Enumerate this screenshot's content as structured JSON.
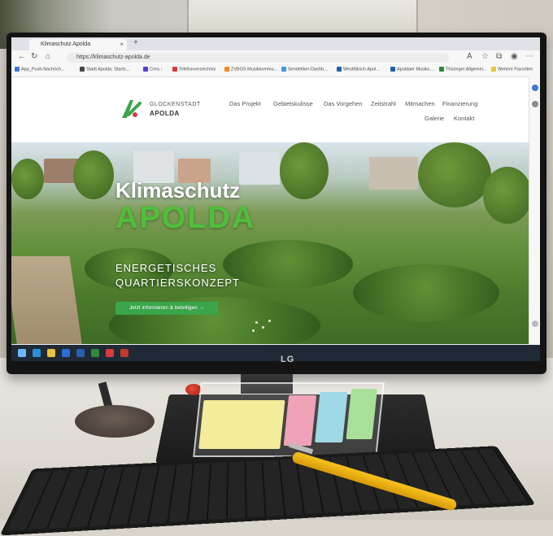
{
  "browser": {
    "tab_title": "Klimaschutz Apolda",
    "tab_close": "×",
    "new_tab": "+",
    "url": "https://klimaschutz-apolda.de",
    "bookmarks": [
      "App_Push-Nachrich...",
      "Stadt Apolda: Starts...",
      "Crea ↑",
      "Telefonverzeichnis",
      "ZVBOS Musikkommu...",
      "Sendetiker-Dashb...",
      "Westfälisch Apol...",
      "Apoldaer Musikc...",
      "Thüringer Allgemei...",
      "Weitere Favoriten"
    ]
  },
  "site": {
    "logo_line1": "GLOCKENSTADT",
    "logo_line2": "APOLDA",
    "nav": [
      "Das Projekt",
      "Gebietskulisse",
      "Das Vorgehen",
      "Zeitstrahl",
      "Mitmachen",
      "Finanzierung",
      "Galerie",
      "Kontakt"
    ],
    "hero_title1": "Klimaschutz",
    "hero_title2": "APOLDA",
    "hero_sub1": "ENERGETISCHES",
    "hero_sub2": "QUARTIERSKONZEPT",
    "cta": "Jetzt informieren & beteiligen →"
  },
  "monitor": {
    "brand": "LG"
  },
  "colors": {
    "accent": "#3aa54a",
    "hero_green": "#4fbf3a"
  }
}
